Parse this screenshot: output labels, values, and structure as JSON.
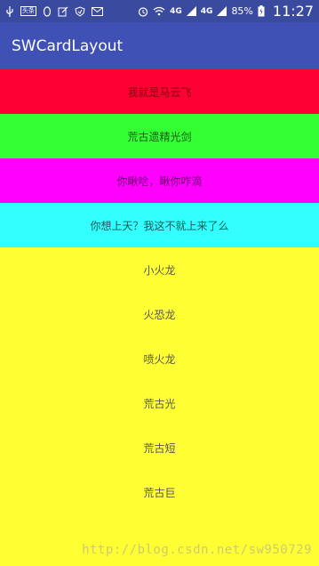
{
  "status_bar": {
    "badge_label": "头条",
    "network_1": "4G",
    "network_2": "4G",
    "battery": "85%",
    "time": "11:27"
  },
  "app": {
    "title": "SWCardLayout"
  },
  "cards": [
    {
      "label": "我就是马云飞",
      "color": "#ff0033"
    },
    {
      "label": "荒古遗精光剑",
      "color": "#33ff33"
    },
    {
      "label": "你瞅啥，瞅你咋滴",
      "color": "#ff00ff"
    },
    {
      "label": "你想上天？我这不就上来了么",
      "color": "#33ffff"
    }
  ],
  "list": {
    "background": "#ffff33",
    "items": [
      "小火龙",
      "火恐龙",
      "喷火龙",
      "荒古光",
      "荒古短",
      "荒古巨"
    ]
  },
  "watermark": "http://blog.csdn.net/sw950729"
}
